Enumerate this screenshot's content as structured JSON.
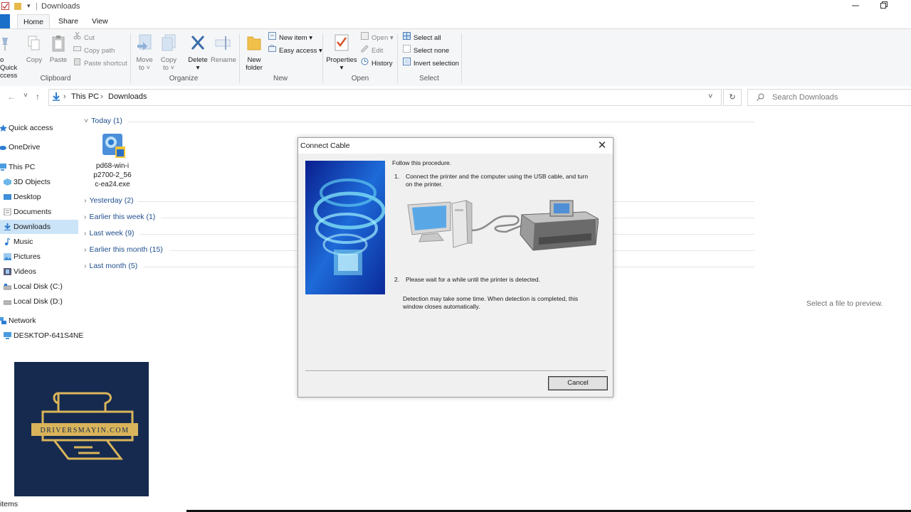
{
  "window": {
    "title": "Downloads",
    "controls": [
      "minimize-icon",
      "restore-icon"
    ]
  },
  "tabs": [
    {
      "label": "Home"
    },
    {
      "label": "Share"
    },
    {
      "label": "View"
    }
  ],
  "ribbon": {
    "clipboard": {
      "pin_label_1": "o Quick",
      "pin_label_2": "ccess",
      "copy": "Copy",
      "paste": "Paste",
      "cut": "Cut",
      "copy_path": "Copy path",
      "paste_shortcut": "Paste shortcut",
      "group": "Clipboard"
    },
    "organize": {
      "move_to_1": "Move",
      "move_to_2": "to ˅",
      "copy_to_1": "Copy",
      "copy_to_2": "to ˅",
      "delete": "Delete",
      "delete_arrow": "▾",
      "rename": "Rename",
      "group": "Organize"
    },
    "new": {
      "new_folder_1": "New",
      "new_folder_2": "folder",
      "new_item": "New item ▾",
      "easy_access": "Easy access ▾",
      "group": "New"
    },
    "open": {
      "properties": "Properties",
      "properties_arrow": "▾",
      "open": "Open ▾",
      "edit": "Edit",
      "history": "History",
      "group": "Open"
    },
    "select": {
      "select_all": "Select all",
      "select_none": "Select none",
      "invert": "Invert selection",
      "group": "Select"
    }
  },
  "address": {
    "back": "←",
    "forward": "→",
    "recent": "˅",
    "up": "↑",
    "crumbs": [
      "This PC",
      "Downloads"
    ],
    "separator": "›",
    "dropdown": "˅",
    "refresh": "↻",
    "search_placeholder": "Search Downloads"
  },
  "sidebar": {
    "items": [
      {
        "label": "Quick access"
      },
      {
        "label": "OneDrive"
      },
      {
        "label": "This PC"
      },
      {
        "label": "3D Objects"
      },
      {
        "label": "Desktop"
      },
      {
        "label": "Documents"
      },
      {
        "label": "Downloads"
      },
      {
        "label": "Music"
      },
      {
        "label": "Pictures"
      },
      {
        "label": "Videos"
      },
      {
        "label": "Local Disk (C:)"
      },
      {
        "label": "Local Disk (D:)"
      },
      {
        "label": "Network"
      },
      {
        "label": "DESKTOP-641S4NE"
      }
    ]
  },
  "files": {
    "groups": [
      {
        "label": "Today (1)",
        "chevron": "˅"
      },
      {
        "label": "Yesterday (2)",
        "chevron": "›"
      },
      {
        "label": "Earlier this week (1)",
        "chevron": "›"
      },
      {
        "label": "Last week (9)",
        "chevron": "›"
      },
      {
        "label": "Earlier this month (15)",
        "chevron": "›"
      },
      {
        "label": "Last month (5)",
        "chevron": "›"
      }
    ],
    "today_file": {
      "line1": "pd68-win-i",
      "line2": "p2700-2_56",
      "line3": "c-ea24.exe"
    }
  },
  "preview": {
    "text": "Select a file to preview."
  },
  "dialog": {
    "title": "Connect Cable",
    "close": "✕",
    "intro": "Follow this procedure.",
    "step1_num": "1.",
    "step1_line1": "Connect the printer and the computer using the USB cable, and turn",
    "step1_line2": "on the printer.",
    "step2_num": "2.",
    "step2": "Please wait for a while until the printer is detected.",
    "note_line1": "Detection may take some time. When detection is completed, this",
    "note_line2": "window closes automatically.",
    "cancel": "Cancel"
  },
  "logo": {
    "text": "DRIVERSMAYIN.COM",
    "color": "#d9b45a",
    "background": "#152a4e"
  },
  "status": {
    "text": "items"
  },
  "colors": {
    "accent": "#1a6fc9",
    "selected": "#cce4f7",
    "group_header": "#1e4e8c"
  }
}
